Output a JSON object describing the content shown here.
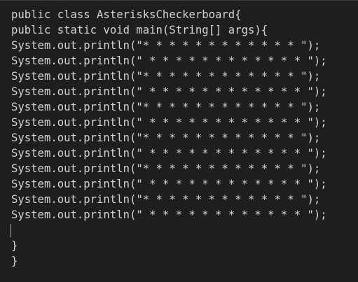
{
  "editor": {
    "lines": [
      "public class AsterisksCheckerboard{",
      "public static void main(String[] args){",
      "System.out.println(\"* * * * * * * * * * * * \");",
      "System.out.println(\" * * * * * * * * * * * * \");",
      "System.out.println(\"* * * * * * * * * * * * \");",
      "System.out.println(\" * * * * * * * * * * * * \");",
      "System.out.println(\"* * * * * * * * * * * * \");",
      "System.out.println(\" * * * * * * * * * * * * \");",
      "System.out.println(\"* * * * * * * * * * * * \");",
      "System.out.println(\" * * * * * * * * * * * * \");",
      "System.out.println(\"* * * * * * * * * * * * \");",
      "System.out.println(\" * * * * * * * * * * * * \");",
      "System.out.println(\"* * * * * * * * * * * * \");",
      "System.out.println(\" * * * * * * * * * * * * \");",
      "",
      "}",
      "}"
    ]
  },
  "colors": {
    "background": "#1e1e1e",
    "text": "#d4d4d4",
    "caret": "#aeafad"
  }
}
